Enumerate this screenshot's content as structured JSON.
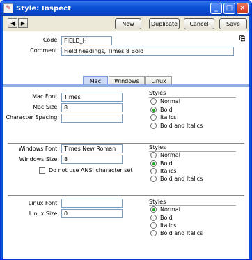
{
  "window": {
    "title": "Style: Inspect"
  },
  "toolbar": {
    "prev_label": "◀",
    "next_label": "▶",
    "new_label": "New",
    "duplicate_label": "Duplicate",
    "cancel_label": "Cancel",
    "save_label": "Save"
  },
  "header": {
    "code_label": "Code:",
    "code_value": "FIELD_H",
    "comment_label": "Comment:",
    "comment_value": "Field headings, Times 8 Bold"
  },
  "tabs": [
    {
      "label": "Mac",
      "active": true
    },
    {
      "label": "Windows",
      "active": false
    },
    {
      "label": "Linux",
      "active": false
    }
  ],
  "mac": {
    "font_label": "Mac Font:",
    "font_value": "Times",
    "size_label": "Mac Size:",
    "size_value": "8",
    "spacing_label": "Character Spacing:",
    "spacing_value": "",
    "styles_title": "Styles",
    "styles": [
      "Normal",
      "Bold",
      "Italics",
      "Bold and Italics"
    ],
    "selected_style": "Bold"
  },
  "windows": {
    "font_label": "Windows Font:",
    "font_value": "Times New Roman",
    "size_label": "Windows Size:",
    "size_value": "8",
    "ansi_label": "Do not use ANSI character set",
    "ansi_checked": false,
    "styles_title": "Styles",
    "styles": [
      "Normal",
      "Bold",
      "Italics",
      "Bold and Italics"
    ],
    "selected_style": "Bold"
  },
  "linux": {
    "font_label": "Linux Font:",
    "font_value": "",
    "size_label": "Linux Size:",
    "size_value": "0",
    "styles_title": "Styles",
    "styles": [
      "Normal",
      "Bold",
      "Italics",
      "Bold and Italics"
    ],
    "selected_style": "Normal"
  },
  "colors": {
    "titlebar": "#0a52d6",
    "tab_band": "#8fb0e4",
    "radio_selected": "#22a322"
  }
}
